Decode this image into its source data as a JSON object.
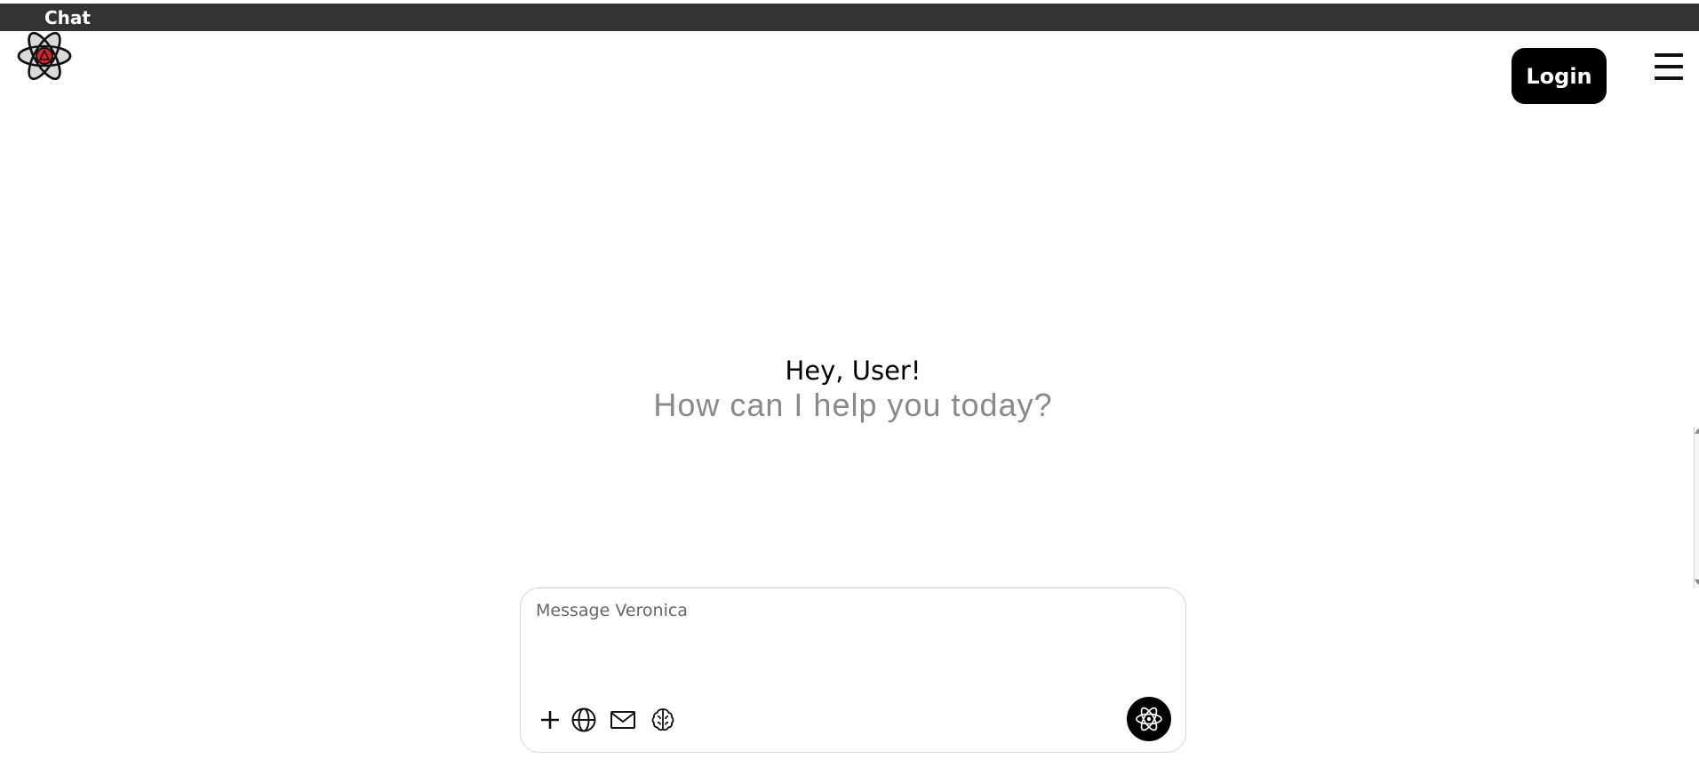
{
  "app": {
    "title": "Chat",
    "logo_icon": "atom-logo-icon"
  },
  "header": {
    "login_label": "Login",
    "menu_icon": "hamburger-menu-icon"
  },
  "hero": {
    "greeting": "Hey, User!",
    "subtitle": "How can I help you today?"
  },
  "composer": {
    "placeholder": "Message Veronica",
    "value": "",
    "tools": [
      {
        "icon": "plus-icon"
      },
      {
        "icon": "globe-icon"
      },
      {
        "icon": "mail-icon"
      },
      {
        "icon": "brain-icon"
      }
    ],
    "send_icon": "atom-icon"
  },
  "colors": {
    "topbar": "#333333",
    "accent": "#000000",
    "logo_core": "#d9232e",
    "subtitle": "#8a8a8a"
  }
}
